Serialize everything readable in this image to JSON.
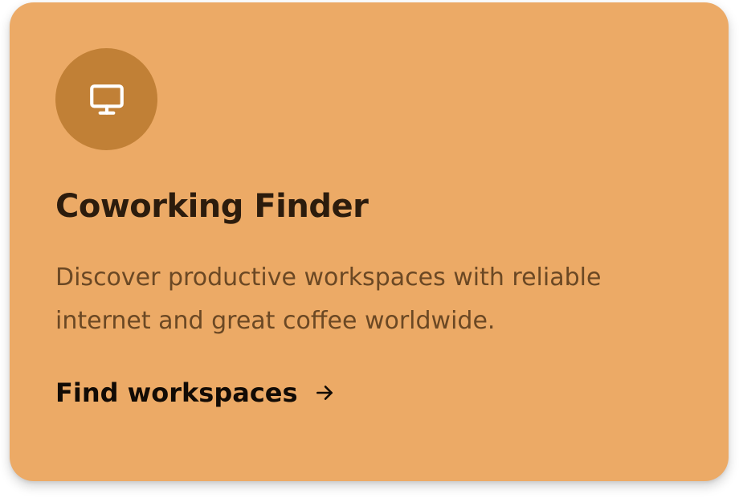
{
  "card": {
    "icon": "monitor-icon",
    "title": "Coworking Finder",
    "description": "Discover productive workspaces with reliable internet and great coffee worldwide.",
    "link_label": "Find workspaces",
    "link_icon": "arrow-right-icon"
  },
  "colors": {
    "card_background": "#ecaa66",
    "icon_circle": "#c18036",
    "icon": "#ffffff",
    "title": "#2c1c0d",
    "description": "#6b4824",
    "link": "#120b05"
  }
}
